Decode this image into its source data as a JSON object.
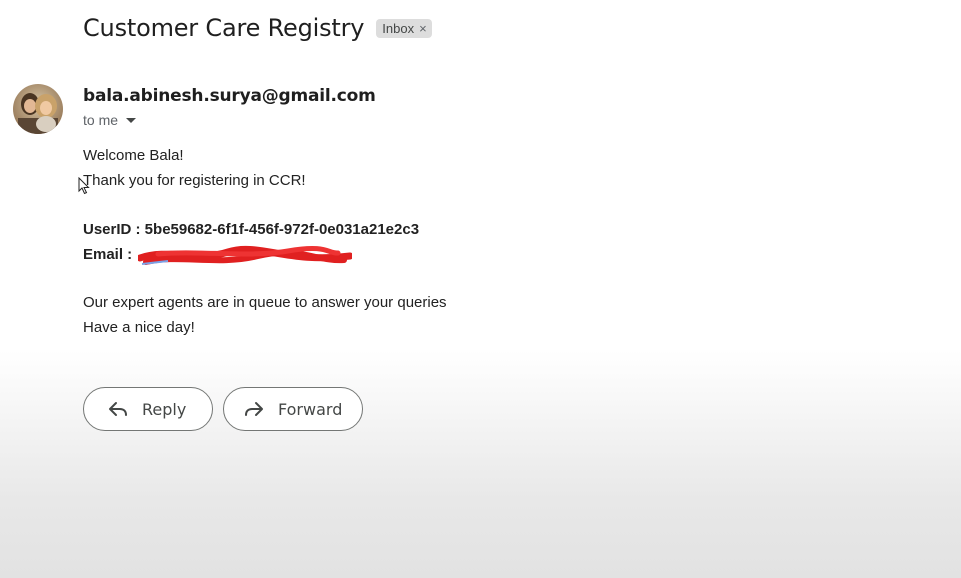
{
  "email": {
    "subject": "Customer Care Registry",
    "label": "Inbox",
    "label_remove": "×",
    "sender": "bala.abinesh.surya@gmail.com",
    "recipient": "to me",
    "body": {
      "greeting": "Welcome Bala!",
      "thanks": "Thank you for registering in CCR!",
      "userid_line": "UserID : 5be59682-6f1f-456f-972f-0e031a21e2c3",
      "email_label": "Email :",
      "queue_line": "Our expert agents are in queue to answer your queries",
      "closing": "Have a nice day!"
    }
  },
  "actions": {
    "reply_label": "Reply",
    "forward_label": "Forward"
  },
  "icons": {
    "avatar": "avatar-photo",
    "cursor": "mouse-pointer-icon",
    "reply": "reply-arrow-icon",
    "forward": "forward-arrow-icon",
    "recipient_details": "caret-down-icon"
  },
  "colors": {
    "redaction": "#e02020",
    "button_border": "#747775"
  }
}
